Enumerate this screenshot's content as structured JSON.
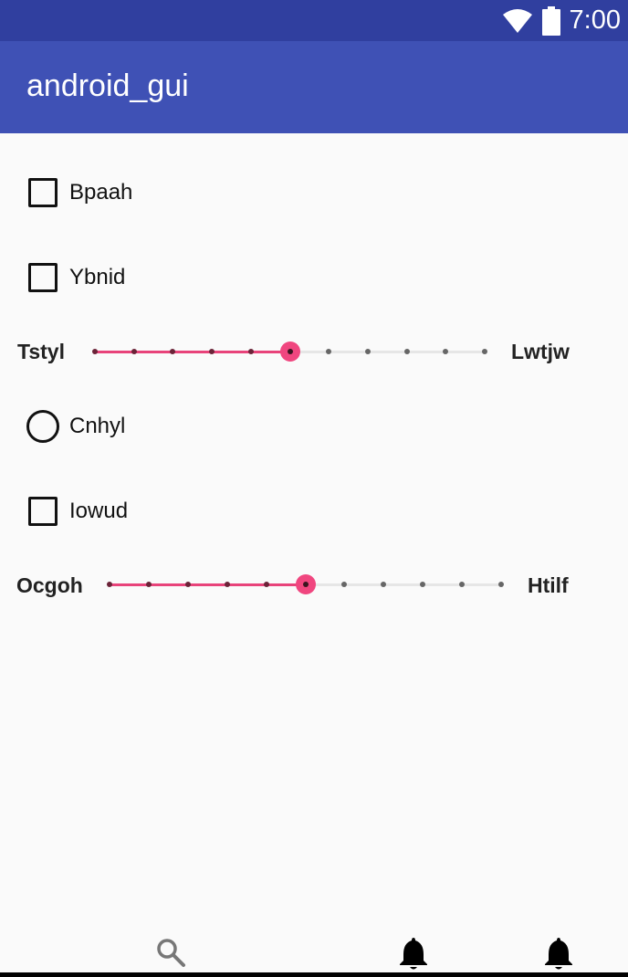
{
  "status_bar": {
    "time": "7:00",
    "icons": [
      "wifi-icon",
      "battery-icon"
    ]
  },
  "app_bar": {
    "title": "android_gui"
  },
  "controls": [
    {
      "type": "checkbox",
      "label": "Bpaah",
      "checked": false
    },
    {
      "type": "checkbox",
      "label": "Ybnid",
      "checked": false
    },
    {
      "type": "slider",
      "left_label": "Tstyl",
      "right_label": "Lwtjw",
      "value": 5,
      "max": 10
    },
    {
      "type": "radio",
      "label": "Cnhyl",
      "checked": false
    },
    {
      "type": "checkbox",
      "label": "Iowud",
      "checked": false
    },
    {
      "type": "slider",
      "left_label": "Ocgoh",
      "right_label": "Htilf",
      "value": 5,
      "max": 10
    }
  ],
  "bottom_nav": {
    "icons": [
      "search-icon",
      "bell-icon",
      "bell-icon"
    ]
  },
  "colors": {
    "status_bar": "#303f9f",
    "app_bar": "#3f51b5",
    "accent": "#f0467f"
  }
}
